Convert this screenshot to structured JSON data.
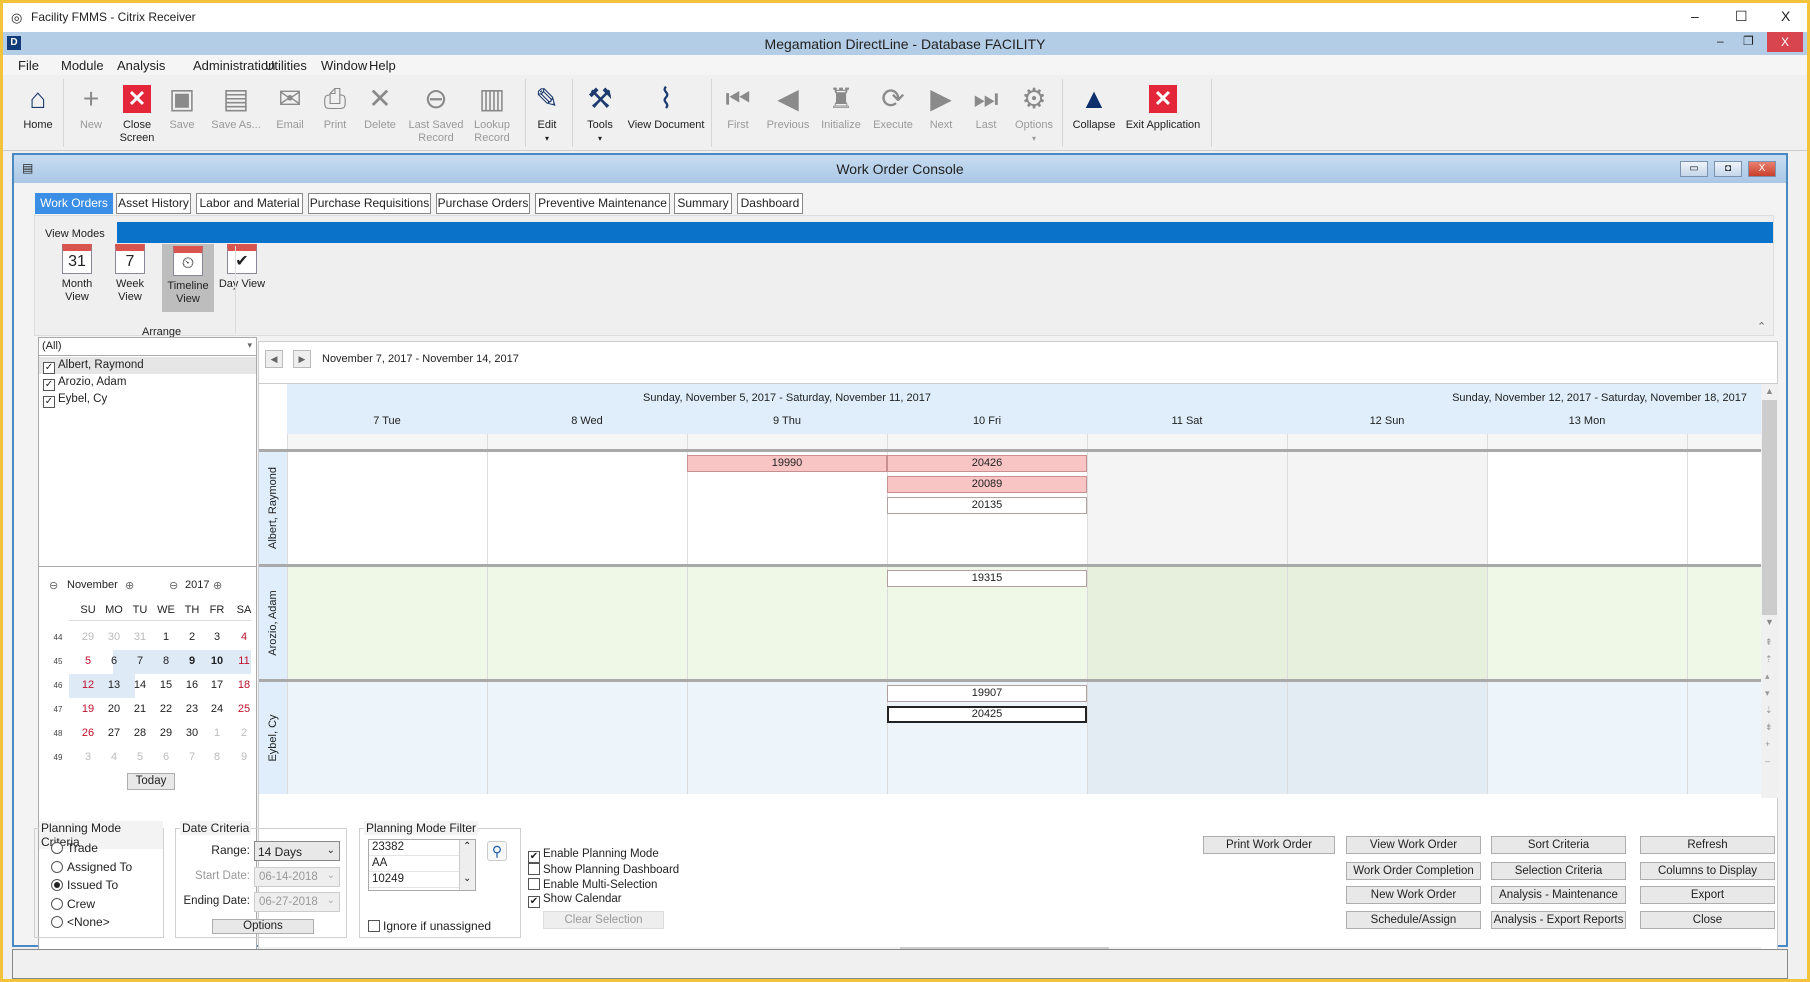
{
  "citrix": {
    "title": "Facility FMMS - Citrix Receiver",
    "controls": [
      "–",
      "☐",
      "X"
    ]
  },
  "app": {
    "title": "Megamation DirectLine - Database FACILITY",
    "controls": [
      "–",
      "❐",
      "X"
    ]
  },
  "menu": [
    "File",
    "Module",
    "Analysis",
    "Administration",
    "Utilities",
    "Window",
    "Help"
  ],
  "toolbar": [
    {
      "label": "Home",
      "icon": "home-icon",
      "glyph": "⌂",
      "enabled": true
    },
    {
      "label": "New",
      "icon": "plus-icon",
      "glyph": "+",
      "enabled": false
    },
    {
      "label": "Close Screen",
      "icon": "close-screen-icon",
      "glyph": "✕",
      "enabled": true,
      "red": true
    },
    {
      "label": "Save",
      "icon": "save-icon",
      "glyph": "▣",
      "enabled": false
    },
    {
      "label": "Save As...",
      "icon": "save-as-icon",
      "glyph": "▤",
      "enabled": false
    },
    {
      "label": "Email",
      "icon": "email-icon",
      "glyph": "✉",
      "enabled": false
    },
    {
      "label": "Print",
      "icon": "print-icon",
      "glyph": "⎙",
      "enabled": false
    },
    {
      "label": "Delete",
      "icon": "delete-icon",
      "glyph": "✕",
      "enabled": false
    },
    {
      "label": "Last Saved Record",
      "icon": "back-circle-icon",
      "glyph": "⊖",
      "enabled": false
    },
    {
      "label": "Lookup Record",
      "icon": "lookup-icon",
      "glyph": "▥",
      "enabled": false
    },
    {
      "label": "Edit",
      "icon": "edit-icon",
      "glyph": "✎",
      "enabled": true,
      "dropdown": true
    },
    {
      "label": "Tools",
      "icon": "tools-icon",
      "glyph": "⚒",
      "enabled": true,
      "dropdown": true
    },
    {
      "label": "View Document",
      "icon": "paperclip-icon",
      "glyph": "⌇",
      "enabled": true
    },
    {
      "label": "First",
      "icon": "first-icon",
      "glyph": "⏮",
      "enabled": false
    },
    {
      "label": "Previous",
      "icon": "previous-icon",
      "glyph": "◀",
      "enabled": false
    },
    {
      "label": "Initialize",
      "icon": "binoculars-icon",
      "glyph": "♜",
      "enabled": false
    },
    {
      "label": "Execute",
      "icon": "refresh-icon",
      "glyph": "⟳",
      "enabled": false
    },
    {
      "label": "Next",
      "icon": "next-icon",
      "glyph": "▶",
      "enabled": false
    },
    {
      "label": "Last",
      "icon": "last-icon",
      "glyph": "⏭",
      "enabled": false
    },
    {
      "label": "Options",
      "icon": "gear-icon",
      "glyph": "⚙",
      "enabled": false,
      "dropdown": true
    },
    {
      "label": "Collapse",
      "icon": "collapse-triangle-icon",
      "glyph": "▲",
      "enabled": true
    },
    {
      "label": "Exit Application",
      "icon": "exit-icon",
      "glyph": "✕",
      "enabled": true,
      "red": true
    }
  ],
  "console": {
    "title": "Work Order Console",
    "controls": [
      "▭",
      "◘",
      "X"
    ]
  },
  "tabs": [
    "Work Orders",
    "Asset History",
    "Labor and Material",
    "Purchase Requisitions",
    "Purchase Orders",
    "Preventive Maintenance",
    "Summary",
    "Dashboard"
  ],
  "active_tab": "Work Orders",
  "view_modes": {
    "tab": "View Modes",
    "group": "Arrange",
    "items": [
      {
        "label": "Month View",
        "glyph": "31"
      },
      {
        "label": "Week View",
        "glyph": "7"
      },
      {
        "label": "Timeline View",
        "glyph": "⏲",
        "active": true
      },
      {
        "label": "Day View",
        "glyph": "✔"
      }
    ]
  },
  "resource_filter": {
    "value": "(All)",
    "items": [
      {
        "name": "Albert, Raymond",
        "checked": true
      },
      {
        "name": "Arozio, Adam",
        "checked": true
      },
      {
        "name": "Eybel, Cy",
        "checked": true
      }
    ]
  },
  "mini_calendar": {
    "month": "November",
    "year": "2017",
    "days": [
      "SU",
      "MO",
      "TU",
      "WE",
      "TH",
      "FR",
      "SA"
    ],
    "weeks": [
      {
        "num": "44",
        "days": [
          "29",
          "30",
          "31",
          "1",
          "2",
          "3",
          "4"
        ]
      },
      {
        "num": "45",
        "days": [
          "5",
          "6",
          "7",
          "8",
          "9",
          "10",
          "11"
        ]
      },
      {
        "num": "46",
        "days": [
          "12",
          "13",
          "14",
          "15",
          "16",
          "17",
          "18"
        ]
      },
      {
        "num": "47",
        "days": [
          "19",
          "20",
          "21",
          "22",
          "23",
          "24",
          "25"
        ]
      },
      {
        "num": "48",
        "days": [
          "26",
          "27",
          "28",
          "29",
          "30",
          "1",
          "2"
        ]
      },
      {
        "num": "49",
        "days": [
          "3",
          "4",
          "5",
          "6",
          "7",
          "8",
          "9"
        ]
      }
    ],
    "today_label": "Today"
  },
  "timeline": {
    "range": "November 7, 2017 - November 14, 2017",
    "week1": "Sunday, November 5, 2017 - Saturday, November 11, 2017",
    "week2": "Sunday, November 12, 2017 - Saturday, November 18, 2017",
    "days": [
      "7 Tue",
      "8 Wed",
      "9 Thu",
      "10 Fri",
      "11 Sat",
      "12 Sun",
      "13 Mon"
    ],
    "resources": [
      {
        "name": "Albert, Raymond",
        "events": [
          {
            "id": "19990",
            "day": 2,
            "slot": 0,
            "style": "pink"
          },
          {
            "id": "20426",
            "day": 3,
            "slot": 0,
            "style": "pink"
          },
          {
            "id": "20089",
            "day": 3,
            "slot": 1,
            "style": "pink"
          },
          {
            "id": "20135",
            "day": 3,
            "slot": 2,
            "style": "white"
          }
        ]
      },
      {
        "name": "Arozio, Adam",
        "events": [
          {
            "id": "19315",
            "day": 3,
            "slot": 0,
            "style": "white"
          }
        ]
      },
      {
        "name": "Eybel, Cy",
        "events": [
          {
            "id": "19907",
            "day": 3,
            "slot": 0,
            "style": "white"
          },
          {
            "id": "20425",
            "day": 3,
            "slot": 1,
            "style": "selected"
          }
        ]
      }
    ]
  },
  "planning_criteria": {
    "title": "Planning Mode Criteria",
    "options": [
      "Trade",
      "Assigned To",
      "Issued To",
      "Crew",
      "<None>"
    ],
    "selected": "Issued To"
  },
  "date_criteria": {
    "title": "Date Criteria",
    "range_label": "Range:",
    "range": "14 Days",
    "start_label": "Start Date:",
    "start": "06-14-2018",
    "end_label": "Ending Date:",
    "end": "06-27-2018",
    "options_label": "Options"
  },
  "planning_filter": {
    "title": "Planning Mode Filter",
    "items": [
      "23382",
      "AA",
      "10249"
    ],
    "ignore_label": "Ignore if unassigned"
  },
  "checkboxes": [
    {
      "label": "Enable Planning Mode",
      "checked": true
    },
    {
      "label": "Show Planning Dashboard",
      "checked": false
    },
    {
      "label": "Enable Multi-Selection",
      "checked": false
    },
    {
      "label": "Show Calendar",
      "checked": true
    }
  ],
  "clear_selection": "Clear Selection",
  "buttons": [
    [
      "Print Work Order",
      "View Work Order",
      "Sort Criteria",
      "Refresh"
    ],
    [
      "",
      "Work Order Completion",
      "Selection Criteria",
      "Columns to Display"
    ],
    [
      "",
      "New Work Order",
      "Analysis - Maintenance",
      "Export"
    ],
    [
      "",
      "Schedule/Assign",
      "Analysis - Export Reports",
      "Close"
    ]
  ]
}
